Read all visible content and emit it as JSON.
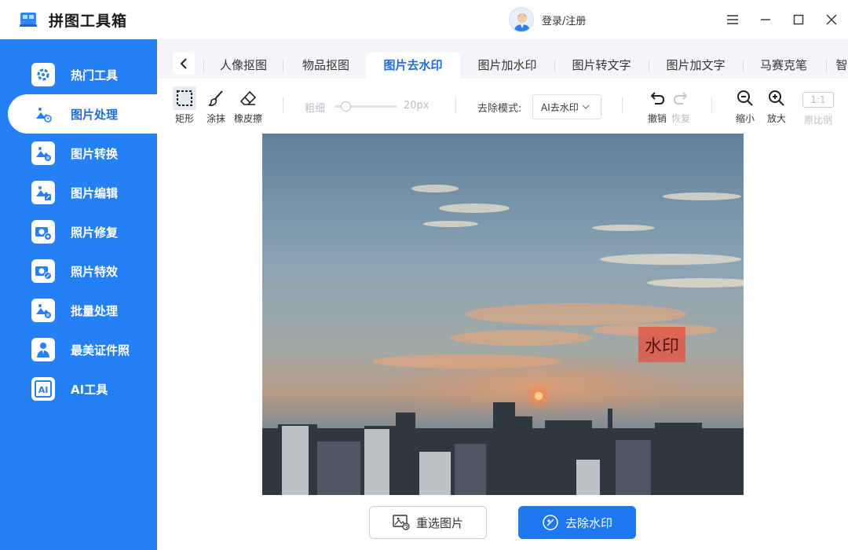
{
  "app": {
    "title": "拼图工具箱",
    "login_label": "登录/注册"
  },
  "sidebar": {
    "items": [
      {
        "label": "热门工具",
        "icon": "gear-icon"
      },
      {
        "label": "图片处理",
        "icon": "image-clock-icon",
        "active": true
      },
      {
        "label": "图片转换",
        "icon": "image-convert-icon"
      },
      {
        "label": "图片编辑",
        "icon": "image-edit-icon"
      },
      {
        "label": "照片修复",
        "icon": "camera-plus-icon"
      },
      {
        "label": "照片特效",
        "icon": "camera-wand-icon"
      },
      {
        "label": "批量处理",
        "icon": "image-batch-icon"
      },
      {
        "label": "最美证件照",
        "icon": "person-id-icon"
      },
      {
        "label": "AI工具",
        "icon": "ai-icon"
      }
    ]
  },
  "tabs": [
    "人像抠图",
    "物品抠图",
    "图片去水印",
    "图片加水印",
    "图片转文字",
    "图片加文字",
    "马赛克笔",
    "智"
  ],
  "active_tab": "图片去水印",
  "toolbar": {
    "rect_label": "矩形",
    "smear_label": "涂抹",
    "eraser_label": "橡皮擦",
    "thickness_label": "粗细",
    "thickness_value": "20px",
    "mode_label": "去除模式:",
    "mode_value": "AI去水印",
    "undo_label": "撤销",
    "redo_label": "恢复",
    "zoom_out_label": "缩小",
    "zoom_in_label": "放大",
    "ratio_box": "1:1",
    "ratio_label": "原比例"
  },
  "canvas": {
    "watermark_text": "水印"
  },
  "actions": {
    "reselect_label": "重选图片",
    "remove_label": "去除水印"
  },
  "colors": {
    "accent": "#2680f5",
    "active_text": "#1f6fe0",
    "watermark_bg": "#e6503c"
  }
}
